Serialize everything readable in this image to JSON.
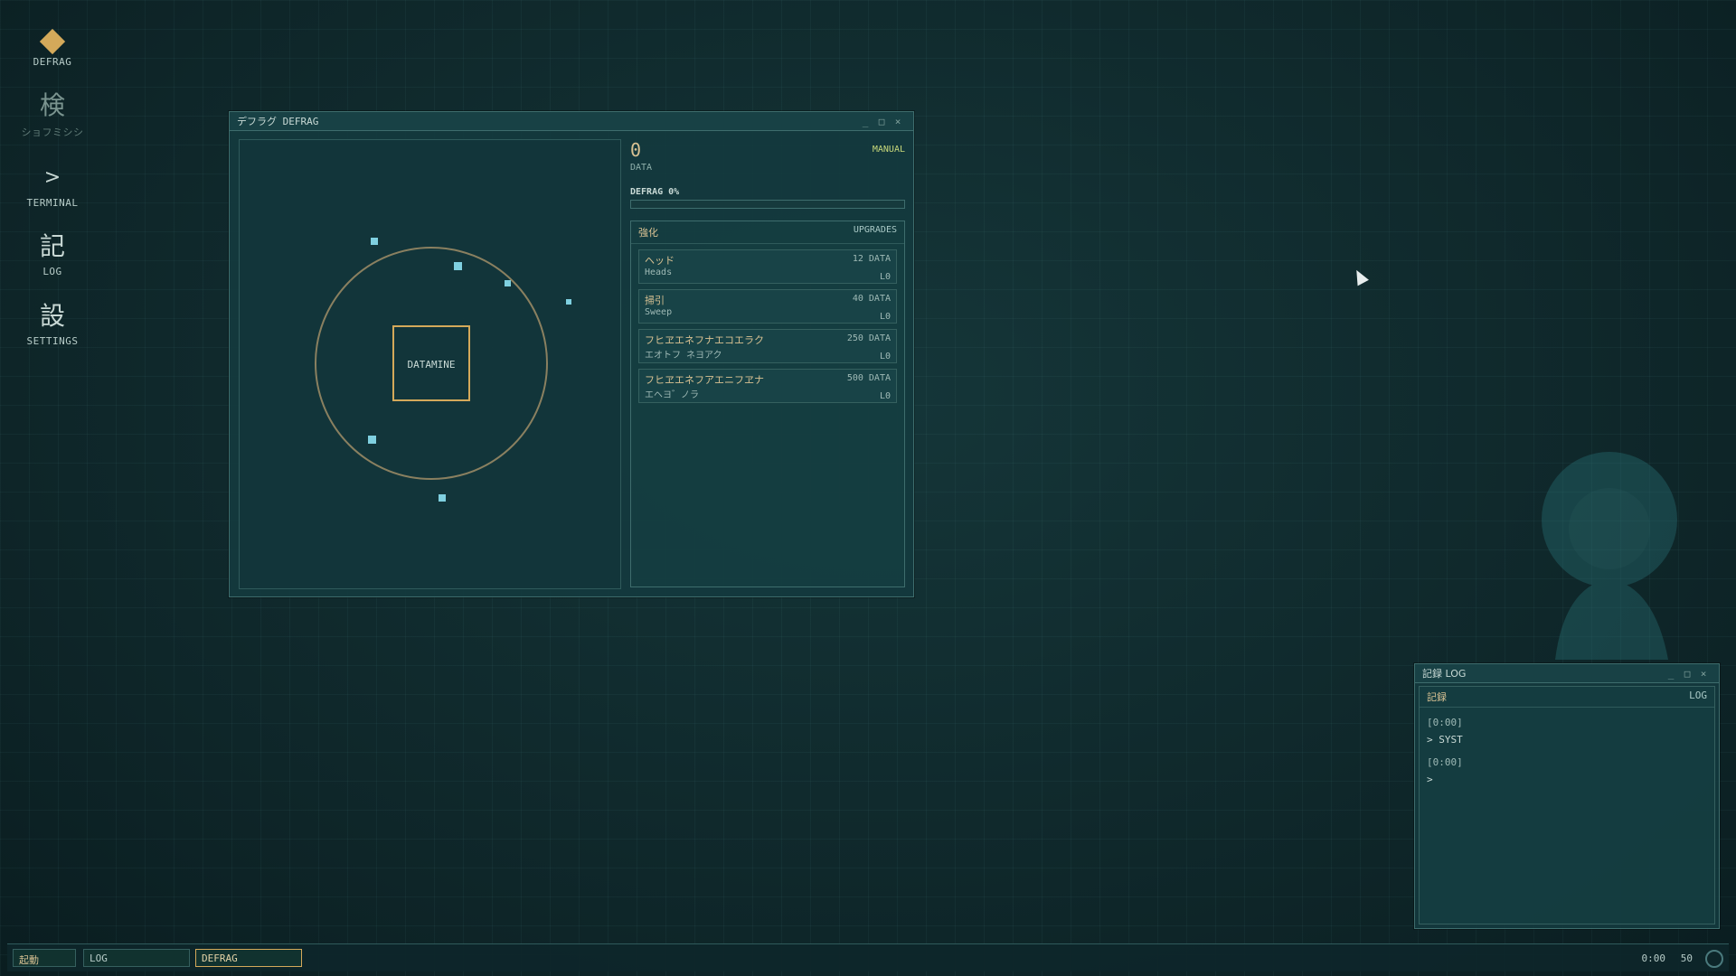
{
  "desktop_icons": [
    {
      "label": "DEFRAG",
      "glyph": "",
      "icon": "diamond-icon"
    },
    {
      "label": "ショフミシシ",
      "glyph": "検",
      "icon": "search-kanji-icon"
    },
    {
      "label": "TERMINAL",
      "glyph": ">",
      "icon": "terminal-icon"
    },
    {
      "label": "LOG",
      "glyph": "記",
      "icon": "log-kanji-icon"
    },
    {
      "label": "SETTINGS",
      "glyph": "設",
      "icon": "settings-kanji-icon"
    }
  ],
  "defrag_window": {
    "title": "デフラグ DEFRAG",
    "controls": {
      "minimize": "_",
      "maximize": "□",
      "close": "×"
    },
    "core_label": "DATAMINE",
    "data_count": "0",
    "data_label": "DATA",
    "mode": "MANUAL",
    "progress_label": "DEFRAG 0%",
    "progress_value": 0,
    "upgrades": {
      "title_jp": "強化",
      "title_en": "UPGRADES",
      "items": [
        {
          "name": "ヘッド",
          "sub": "Heads",
          "cost": "12 DATA",
          "level": "L0"
        },
        {
          "name": "掃引",
          "sub": "Sweep",
          "cost": "40 DATA",
          "level": "L0"
        },
        {
          "name": "フヒヱエネフナエコエラク",
          "sub": "エオトフ ネヨアク",
          "cost": "250 DATA",
          "level": "L0"
        },
        {
          "name": "フヒヱエネフアエニフヱナ",
          "sub": "エヘヨ゛ノラ",
          "cost": "500 DATA",
          "level": "L0"
        }
      ]
    }
  },
  "log_window": {
    "title": "記録 LOG",
    "controls": {
      "minimize": "_",
      "maximize": "□",
      "close": "×"
    },
    "header_jp": "記録",
    "header_en": "LOG",
    "entries": [
      {
        "ts": "[0:00]",
        "text": "> SYST"
      },
      {
        "ts": "[0:00]",
        "text": ">"
      }
    ]
  },
  "taskbar": {
    "start": "起動",
    "tasks": [
      "LOG",
      "DEFRAG"
    ],
    "clock": "0:00",
    "fps": "50"
  },
  "colors": {
    "accent": "#d4a95a",
    "background": "#0f2a2d",
    "node": "#7fd0e0"
  }
}
